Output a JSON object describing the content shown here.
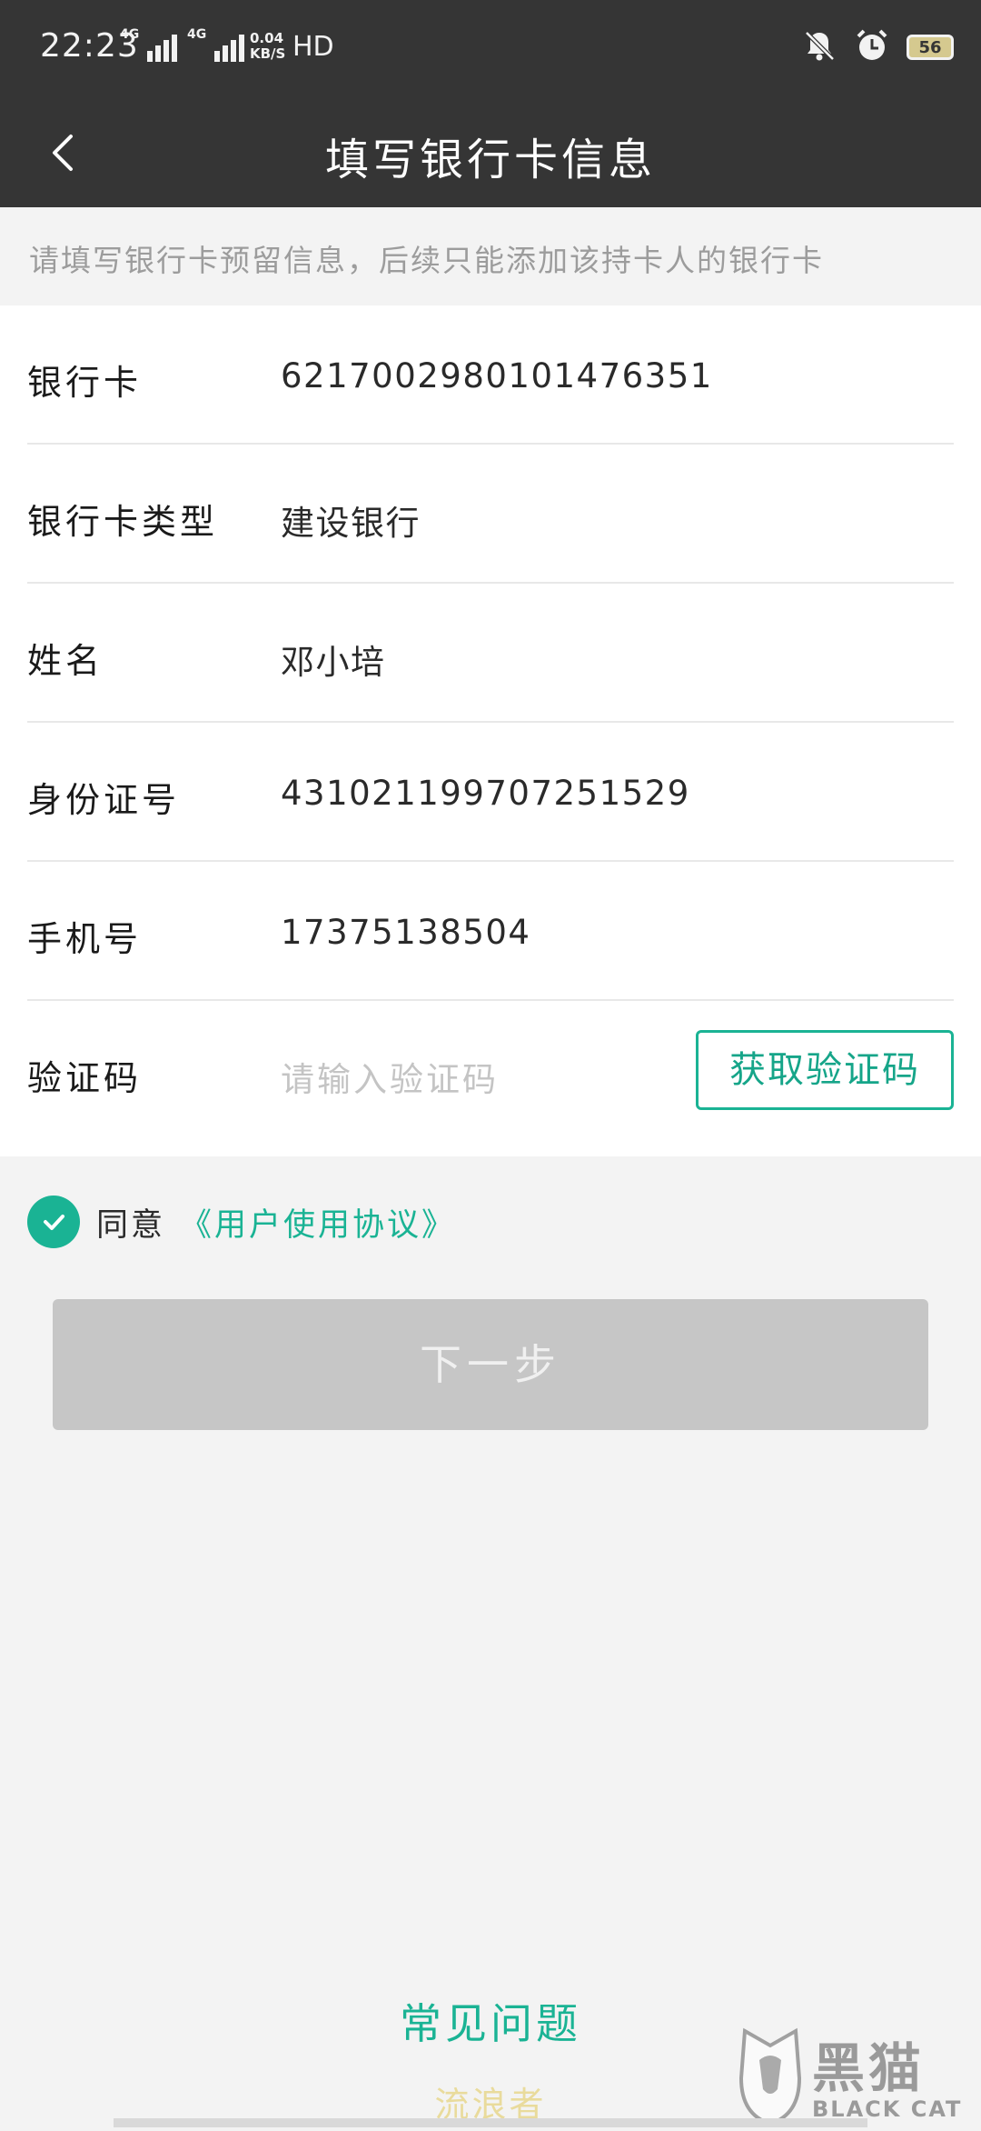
{
  "status_bar": {
    "time": "22:23",
    "network_1": "4G",
    "network_2": "4G",
    "speed_value": "0.04",
    "speed_unit": "KB/S",
    "hd": "HD",
    "battery": "56"
  },
  "header": {
    "title": "填写银行卡信息",
    "back_icon": "chevron-left-icon"
  },
  "notice": "请填写银行卡预留信息，后续只能添加该持卡人的银行卡",
  "form": {
    "rows": [
      {
        "label": "银行卡",
        "value": "6217002980101476351"
      },
      {
        "label": "银行卡类型",
        "value": "建设银行"
      },
      {
        "label": "姓名",
        "value": "邓小培"
      },
      {
        "label": "身份证号",
        "value": "431021199707251529"
      },
      {
        "label": "手机号",
        "value": "17375138504"
      }
    ],
    "code": {
      "label": "验证码",
      "placeholder": "请输入验证码",
      "button": "获取验证码"
    }
  },
  "agreement": {
    "checked": true,
    "text": "同意",
    "link": "《用户使用协议》"
  },
  "next_button": "下一步",
  "faq": "常见问题",
  "watermark": {
    "user": "流浪者",
    "brand": "黑猫",
    "brand_en": "BLACK CAT"
  },
  "colors": {
    "accent": "#1ab394",
    "header_bg": "#353535",
    "disabled_button": "#c6c6c6"
  }
}
